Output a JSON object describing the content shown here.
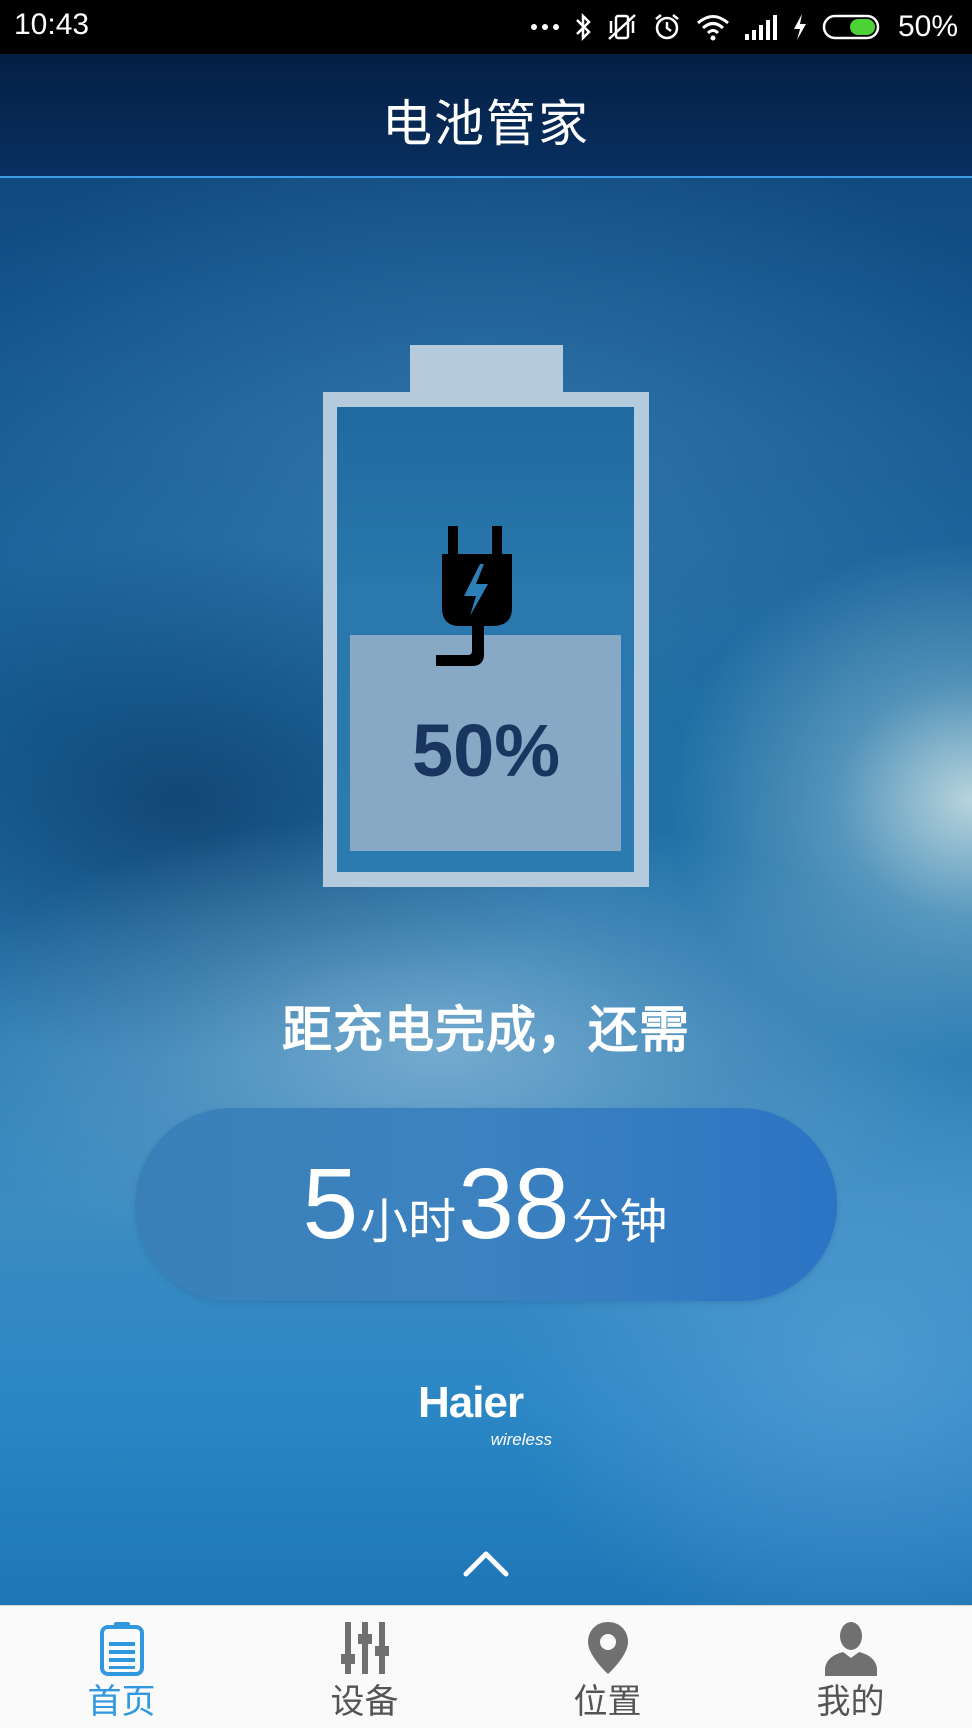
{
  "status_bar": {
    "time": "10:43",
    "battery_text": "50%",
    "icons": [
      "more-dots-icon",
      "bluetooth-icon",
      "vibrate-off-icon",
      "alarm-icon",
      "wifi-icon",
      "signal-icon",
      "charging-bolt-icon",
      "battery-icon"
    ],
    "battery_level": 0.5,
    "battery_color": "#4cd137"
  },
  "header": {
    "title": "电池管家"
  },
  "battery": {
    "percent_text": "50%",
    "level": 0.5,
    "icon": "plug-charging-icon"
  },
  "charge": {
    "label": "距充电完成，还需",
    "hours": "5",
    "hours_unit": "小时",
    "minutes": "38",
    "minutes_unit": "分钟"
  },
  "logo": {
    "main": "Haier",
    "sub": "wireless"
  },
  "nav": {
    "items": [
      {
        "label": "首页",
        "icon": "battery-home-icon",
        "active": true
      },
      {
        "label": "设备",
        "icon": "sliders-icon",
        "active": false
      },
      {
        "label": "位置",
        "icon": "location-pin-icon",
        "active": false
      },
      {
        "label": "我的",
        "icon": "user-icon",
        "active": false
      }
    ]
  },
  "colors": {
    "accent": "#2f98de",
    "header_bg": "#041f44",
    "nav_inactive": "#545454"
  }
}
